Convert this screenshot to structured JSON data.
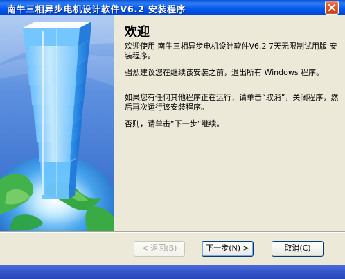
{
  "window": {
    "title": "南牛三相异步电机设计软件V6.2 安装程序"
  },
  "welcome": {
    "heading": "欢迎",
    "paragraphs": [
      "欢迎使用 南牛三相异步电机设计软件V6.2 7天无限制试用版 安装程序。",
      "强烈建议您在继续该安装之前，退出所有 Windows 程序。",
      "如果您有任何其他程序正在运行，请单击“取消”，关闭程序，然后再次运行该安装程序。",
      "否则，请单击“下一步”继续。"
    ]
  },
  "buttons": {
    "back_label": "< 返回(B)",
    "next_label": "下一步(N) >",
    "cancel_label": "取消(C)"
  },
  "icons": {
    "close": "close-icon",
    "illustration": "tower-globe-illustration"
  },
  "colors": {
    "title_bar": "#0058ee",
    "dialog_background": "#ece9d8",
    "left_panel_blue": "#4b84db",
    "close_button": "#e45a2a"
  }
}
